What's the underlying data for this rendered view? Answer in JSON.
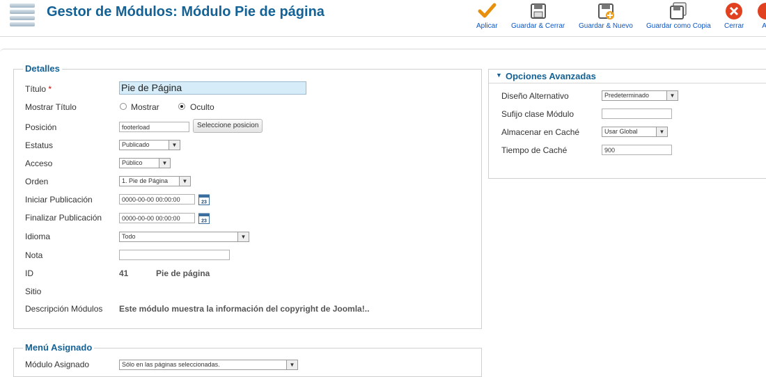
{
  "header": {
    "title": "Gestor de Módulos: Módulo Pie de página"
  },
  "toolbar": {
    "apply": "Aplicar",
    "save_close": "Guardar & Cerrar",
    "save_new": "Guardar & Nuevo",
    "save_copy": "Guardar como Copia",
    "close": "Cerrar",
    "help": "Ay"
  },
  "details": {
    "legend": "Detalles",
    "title_label": "Título",
    "required_mark": "*",
    "title_value": "Pie de Página",
    "show_title_label": "Mostrar Título",
    "show_option": "Mostrar",
    "hide_option": "Oculto",
    "show_title_selected": "Oculto",
    "position_label": "Posición",
    "position_value": "footerload",
    "select_position_button": "Seleccione posicion",
    "status_label": "Estatus",
    "status_value": "Publicado",
    "access_label": "Acceso",
    "access_value": "Público",
    "order_label": "Orden",
    "order_value": "1. Pie de Página",
    "publish_up_label": "Iniciar Publicación",
    "publish_up_value": "0000-00-00 00:00:00",
    "publish_down_label": "Finalizar Publicación",
    "publish_down_value": "0000-00-00 00:00:00",
    "language_label": "Idioma",
    "language_value": "Todo",
    "note_label": "Nota",
    "note_value": "",
    "id_label": "ID",
    "id_value": "41",
    "id_name": "Pie de página",
    "site_label": "Sitio",
    "description_label": "Descripción Módulos",
    "description_value": "Este módulo muestra la información del copyright de Joomla!.."
  },
  "advanced": {
    "legend": "Opciones Avanzadas",
    "layout_label": "Diseño Alternativo",
    "layout_value": "Predeterminado",
    "suffix_label": "Sufijo clase Módulo",
    "suffix_value": "",
    "cache_label": "Almacenar en Caché",
    "cache_value": "Usar Global",
    "cache_time_label": "Tiempo de Caché",
    "cache_time_value": "900"
  },
  "menu_assignment": {
    "legend": "Menú Asignado",
    "module_assigned_label": "Módulo Asignado",
    "module_assigned_value": "Sólo en las páginas seleccionadas."
  },
  "icons": {
    "calendar_text": "23"
  }
}
